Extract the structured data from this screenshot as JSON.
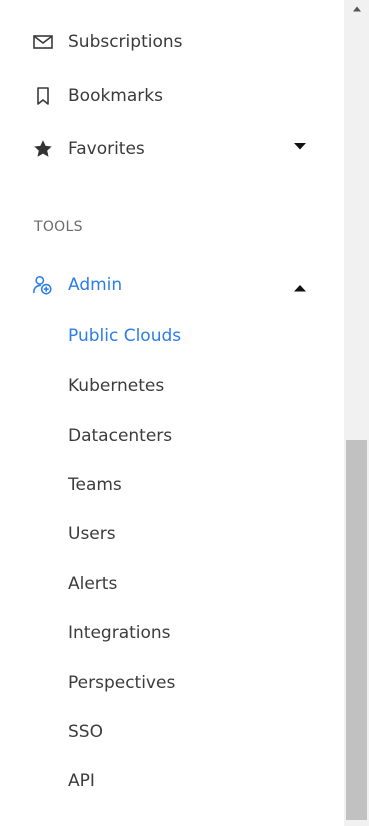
{
  "sidebar": {
    "items": [
      {
        "label": "Subscriptions",
        "icon": "mail-icon"
      },
      {
        "label": "Bookmarks",
        "icon": "bookmark-icon"
      },
      {
        "label": "Favorites",
        "icon": "star-icon",
        "expanded": false
      }
    ],
    "tools_heading": "TOOLS",
    "admin": {
      "label": "Admin",
      "icon": "user-add-icon",
      "expanded": true,
      "children": [
        {
          "label": "Public Clouds",
          "active": true
        },
        {
          "label": "Kubernetes",
          "active": false
        },
        {
          "label": "Datacenters",
          "active": false
        },
        {
          "label": "Teams",
          "active": false
        },
        {
          "label": "Users",
          "active": false
        },
        {
          "label": "Alerts",
          "active": false
        },
        {
          "label": "Integrations",
          "active": false
        },
        {
          "label": "Perspectives",
          "active": false
        },
        {
          "label": "SSO",
          "active": false
        },
        {
          "label": "API",
          "active": false
        }
      ]
    }
  },
  "colors": {
    "accent": "#2b7de9",
    "text": "#3a3a3a",
    "muted": "#6b6b6b",
    "scroll_track": "#f1f1f1",
    "scroll_thumb": "#c1c1c1"
  }
}
